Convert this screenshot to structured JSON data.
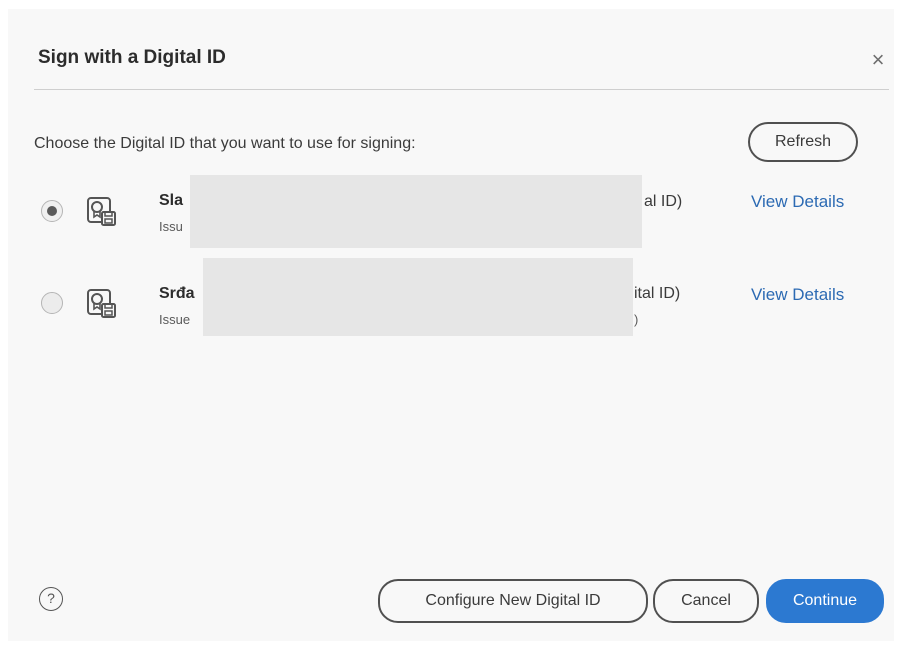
{
  "dialog": {
    "title": "Sign with a Digital ID",
    "close_icon": "×"
  },
  "instruction": "Choose the Digital ID that you want to use for signing:",
  "refresh_label": "Refresh",
  "ids": [
    {
      "selected": true,
      "name_visible": "Sla",
      "issuer_visible": "Issu",
      "suffix_visible": "al ID)",
      "details_label": "View Details"
    },
    {
      "selected": false,
      "name_visible": "Srđa",
      "issuer_visible": "Issue",
      "suffix_visible": "ital ID)",
      "tail_visible": ")",
      "details_label": "View Details"
    }
  ],
  "footer": {
    "help_icon": "?",
    "configure_label": "Configure New Digital ID",
    "cancel_label": "Cancel",
    "continue_label": "Continue"
  },
  "colors": {
    "accent": "#2c79d1",
    "link": "#2c6ab3",
    "dialog_background": "#f8f8f8",
    "redaction": "#e6e6e6"
  }
}
